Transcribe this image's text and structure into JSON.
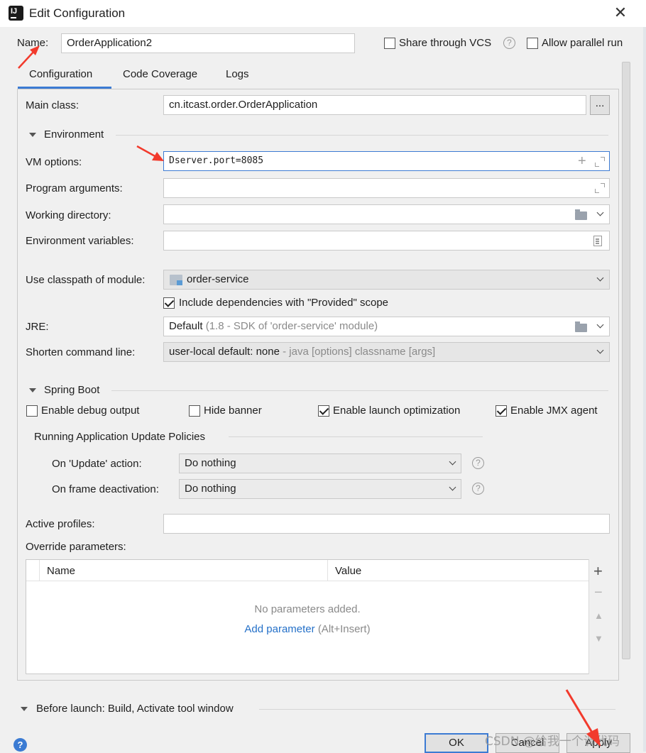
{
  "window": {
    "title": "Edit Configuration",
    "close_symbol": "✕",
    "app_icon_text": "IJ"
  },
  "header": {
    "name_label": "Name:",
    "name_value": "OrderApplication2",
    "share_vcs_label": "Share through VCS",
    "share_vcs_checked": false,
    "allow_parallel_label": "Allow parallel run",
    "allow_parallel_checked": false,
    "help_symbol": "?"
  },
  "tabs": [
    {
      "label": "Configuration",
      "active": true
    },
    {
      "label": "Code Coverage",
      "active": false
    },
    {
      "label": "Logs",
      "active": false
    }
  ],
  "main_class": {
    "label": "Main class:",
    "value": "cn.itcast.order.OrderApplication",
    "browse_label": "..."
  },
  "environment": {
    "title": "Environment",
    "vm_options": {
      "label": "VM options:",
      "value": "Dserver.port=8085"
    },
    "program_arguments": {
      "label": "Program arguments:",
      "value": ""
    },
    "working_directory": {
      "label": "Working directory:",
      "value": ""
    },
    "environment_variables": {
      "label": "Environment variables:",
      "value": ""
    }
  },
  "classpath": {
    "label": "Use classpath of module:",
    "value": "order-service",
    "include_provided_label": "Include dependencies with \"Provided\" scope",
    "include_provided_checked": true
  },
  "jre": {
    "label": "JRE:",
    "value": "Default",
    "detail": "(1.8 - SDK of 'order-service' module)"
  },
  "shorten_command_line": {
    "label": "Shorten command line:",
    "value": "user-local default: none",
    "detail": "- java [options] classname [args]"
  },
  "spring_boot": {
    "title": "Spring Boot",
    "options": [
      {
        "label": "Enable debug output",
        "checked": false
      },
      {
        "label": "Hide banner",
        "checked": false
      },
      {
        "label": "Enable launch optimization",
        "checked": true
      },
      {
        "label": "Enable JMX agent",
        "checked": true
      }
    ],
    "policies_title": "Running Application Update Policies",
    "update_action": {
      "label": "On 'Update' action:",
      "value": "Do nothing"
    },
    "frame_deactivation": {
      "label": "On frame deactivation:",
      "value": "Do nothing"
    }
  },
  "active_profiles": {
    "label": "Active profiles:",
    "value": ""
  },
  "override_parameters": {
    "label": "Override parameters:",
    "columns": [
      "Name",
      "Value"
    ],
    "empty_text": "No parameters added.",
    "add_link": "Add parameter",
    "add_shortcut": "(Alt+Insert)",
    "side_buttons": [
      "+",
      "−",
      "▲",
      "▼"
    ]
  },
  "before_launch": {
    "label": "Before launch: Build, Activate tool window"
  },
  "footer": {
    "ok_label": "OK",
    "cancel_label": "Cancel",
    "apply_label": "Apply",
    "watermark": "CSDN @给我一个调代码",
    "help_symbol": "?"
  },
  "colors": {
    "accent": "#3c7bd3",
    "annotation_arrow": "#f23a2c",
    "link": "#2470c8"
  }
}
